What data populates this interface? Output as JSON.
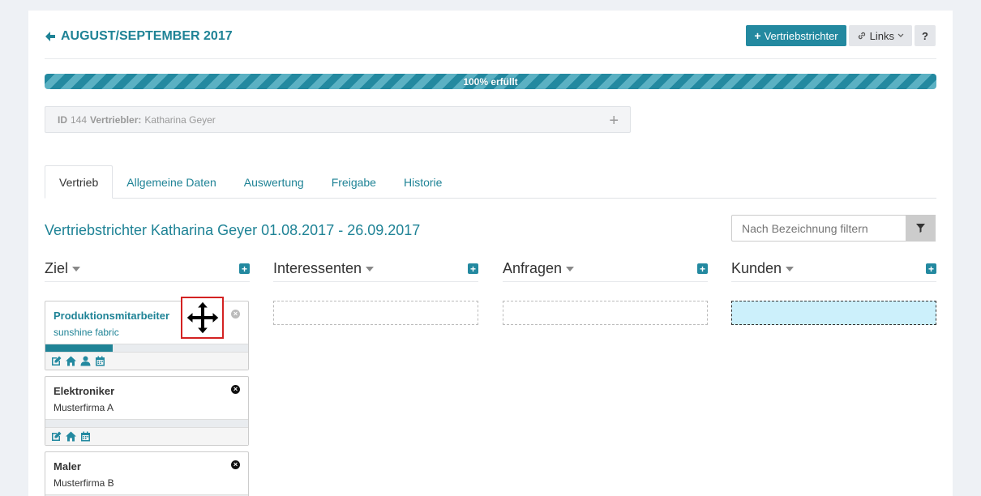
{
  "header": {
    "back_title": "AUGUST/SEPTEMBER 2017"
  },
  "toolbar": {
    "add_label": "Vertriebstrichter",
    "links_label": "Links",
    "help_label": "?"
  },
  "progress": {
    "label": "100% erfüllt",
    "percent": 100
  },
  "info": {
    "id_label": "ID",
    "id_value": "144",
    "sales_label": "Vertriebler:",
    "sales_value": "Katharina Geyer",
    "add_symbol": "+"
  },
  "tabs": [
    {
      "label": "Vertrieb",
      "active": true
    },
    {
      "label": "Allgemeine Daten"
    },
    {
      "label": "Auswertung"
    },
    {
      "label": "Freigabe"
    },
    {
      "label": "Historie"
    }
  ],
  "main": {
    "title": "Vertriebstrichter Katharina Geyer 01.08.2017 - 26.09.2017",
    "filter_placeholder": "Nach Bezeichnung filtern"
  },
  "columns": [
    {
      "label": "Ziel"
    },
    {
      "label": "Interessenten"
    },
    {
      "label": "Anfragen"
    },
    {
      "label": "Kunden"
    }
  ],
  "cards": [
    {
      "title": "Produktionsmitarbeiter",
      "company": "sunshine fabric",
      "progress": 0.33
    },
    {
      "title": "Elektroniker",
      "company": "Musterfirma A",
      "progress": 0
    },
    {
      "title": "Maler",
      "company": "Musterfirma B",
      "progress": 0
    }
  ],
  "colors": {
    "accent": "#2389a0",
    "accent_dark": "#1f8396",
    "dropzone_active": "#ccf0fb",
    "drag_outline": "#d32222"
  }
}
